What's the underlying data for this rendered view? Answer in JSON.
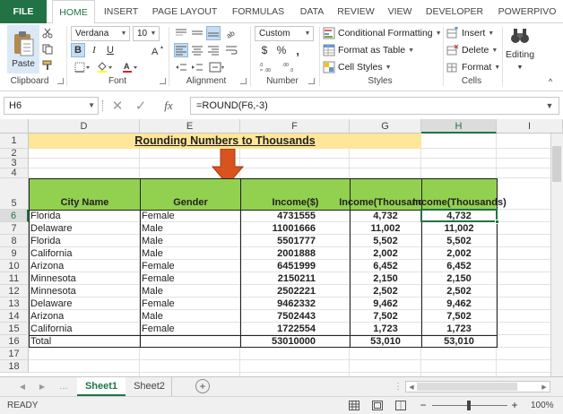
{
  "ribbon_tabs": [
    "FILE",
    "HOME",
    "INSERT",
    "PAGE LAYOUT",
    "FORMULAS",
    "DATA",
    "REVIEW",
    "VIEW",
    "DEVELOPER",
    "POWERPIVO"
  ],
  "ribbon": {
    "clipboard": {
      "label": "Clipboard",
      "paste_label": "Paste"
    },
    "font": {
      "label": "Font",
      "font_name": "Verdana",
      "font_size": "10",
      "bold": "B",
      "italic": "I",
      "underline": "U"
    },
    "alignment": {
      "label": "Alignment"
    },
    "number": {
      "label": "Number",
      "format": "Custom",
      "currency": "$",
      "percent": "%",
      "comma": ","
    },
    "styles": {
      "label": "Styles",
      "conditional": "Conditional Formatting",
      "table": "Format as Table",
      "cell_styles": "Cell Styles"
    },
    "cells": {
      "label": "Cells",
      "insert": "Insert",
      "delete": "Delete",
      "format": "Format"
    },
    "editing": {
      "label": "Editing"
    }
  },
  "formula_bar": {
    "name_box": "H6",
    "formula": "=ROUND(F6,-3)",
    "fx": "fx"
  },
  "sheet": {
    "columns": [
      "D",
      "E",
      "F",
      "G",
      "H",
      "I"
    ],
    "selected_column": "H",
    "rows": [
      "1",
      "2",
      "3",
      "4",
      "5",
      "6",
      "7",
      "8",
      "9",
      "10",
      "11",
      "12",
      "13",
      "14",
      "15",
      "16",
      "17",
      "18"
    ],
    "selected_row": "6",
    "title": "Rounding Numbers to Thousands",
    "headers": {
      "city": "City Name",
      "gender": "Gender",
      "income": "Income($)",
      "income_thousands_g_1": "Income",
      "income_thousands_g_2": "(Thousands)",
      "income_thousands_h_1": "Income",
      "income_thousands_h_2": "(Thousands)"
    },
    "data": [
      {
        "city": "Florida",
        "gender": "Female",
        "income": "4731555",
        "g": "4,732",
        "h": "4,732"
      },
      {
        "city": "Delaware",
        "gender": "Male",
        "income": "11001666",
        "g": "11,002",
        "h": "11,002"
      },
      {
        "city": "Florida",
        "gender": "Male",
        "income": "5501777",
        "g": "5,502",
        "h": "5,502"
      },
      {
        "city": "California",
        "gender": "Male",
        "income": "2001888",
        "g": "2,002",
        "h": "2,002"
      },
      {
        "city": "Arizona",
        "gender": "Female",
        "income": "6451999",
        "g": "6,452",
        "h": "6,452"
      },
      {
        "city": "Minnesota",
        "gender": "Female",
        "income": "2150211",
        "g": "2,150",
        "h": "2,150"
      },
      {
        "city": "Minnesota",
        "gender": "Male",
        "income": "2502221",
        "g": "2,502",
        "h": "2,502"
      },
      {
        "city": "Delaware",
        "gender": "Female",
        "income": "9462332",
        "g": "9,462",
        "h": "9,462"
      },
      {
        "city": "Arizona",
        "gender": "Male",
        "income": "7502443",
        "g": "7,502",
        "h": "7,502"
      },
      {
        "city": "California",
        "gender": "Female",
        "income": "1722554",
        "g": "1,723",
        "h": "1,723"
      }
    ],
    "total": {
      "label": "Total",
      "income": "53010000",
      "g": "53,010",
      "h": "53,010"
    }
  },
  "sheet_tabs": [
    "Sheet1",
    "Sheet2"
  ],
  "status": {
    "ready": "READY",
    "zoom": "100%"
  },
  "colors": {
    "accent": "#217346",
    "header_fill": "#92d050",
    "title_fill": "#ffe699",
    "arrow": "#d9531e"
  }
}
